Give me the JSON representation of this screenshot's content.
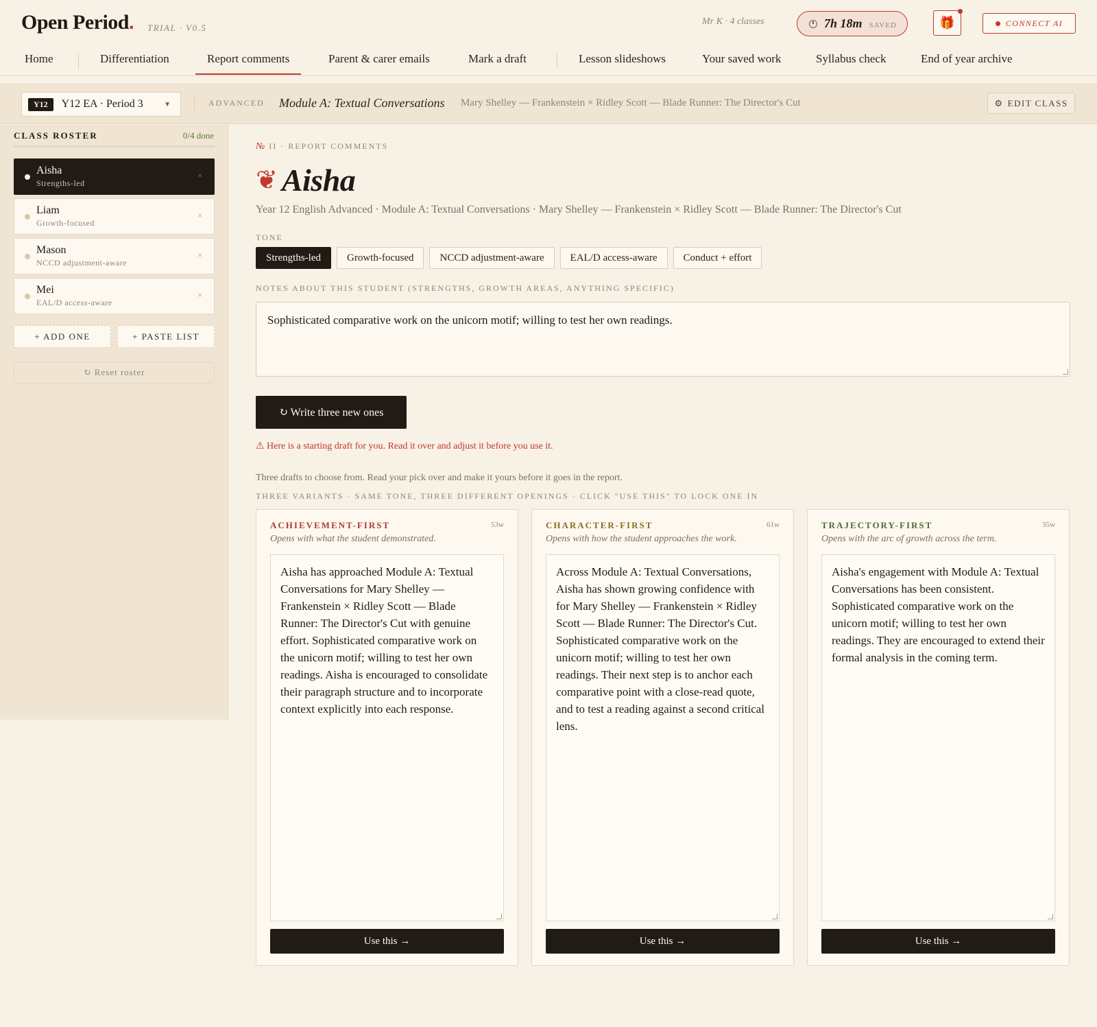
{
  "app": {
    "logo": "Open Period",
    "logo_dot": ".",
    "version": "TRIAL · V0.5",
    "teacher": "Mr K · 4 classes",
    "time_saved": "7h 18m",
    "time_saved_label": "SAVED",
    "gift_icon": "🎁",
    "connect_label": "CONNECT AI"
  },
  "nav": {
    "items": [
      "Home",
      "Differentiation",
      "Report comments",
      "Parent & carer emails",
      "Mark a draft",
      "Lesson slideshows",
      "Your saved work",
      "Syllabus check",
      "End of year archive"
    ],
    "active": "Report comments"
  },
  "classbar": {
    "badge": "Y12",
    "class_name": "Y12 EA · Period 3",
    "level": "ADVANCED",
    "module": "Module A: Textual Conversations",
    "texts": "Mary Shelley — Frankenstein × Ridley Scott — Blade Runner: The Director's Cut",
    "edit_label": "EDIT CLASS"
  },
  "roster": {
    "title": "CLASS ROSTER",
    "done": "0/4 done",
    "students": [
      {
        "name": "Aisha",
        "tone": "Strengths-led"
      },
      {
        "name": "Liam",
        "tone": "Growth-focused"
      },
      {
        "name": "Mason",
        "tone": "NCCD adjustment-aware"
      },
      {
        "name": "Mei",
        "tone": "EAL/D access-aware"
      }
    ],
    "remove_glyph": "×",
    "add_one": "+ ADD ONE",
    "paste_list": "+ PASTE LIST",
    "reset": "↻ Reset roster"
  },
  "main": {
    "kicker_no": "№",
    "kicker": "II · REPORT COMMENTS",
    "student_name": "Aisha",
    "apple_glyph": "❦",
    "subline": "Year 12 English Advanced · Module A: Textual Conversations · Mary Shelley — Frankenstein × Ridley Scott — Blade Runner: The Director's Cut",
    "tone_label": "TONE",
    "tones": [
      "Strengths-led",
      "Growth-focused",
      "NCCD adjustment-aware",
      "EAL/D access-aware",
      "Conduct + effort"
    ],
    "active_tone": "Strengths-led",
    "notes_label": "NOTES ABOUT THIS STUDENT (STRENGTHS, GROWTH AREAS, ANYTHING SPECIFIC)",
    "notes": "Sophisticated comparative work on the unicorn motif; willing to test her own readings.",
    "write_button": "↻ Write three new ones",
    "warning": "⚠ Here is a starting draft for you. Read it over and adjust it before you use it.",
    "drafts_intro": "Three drafts to choose from. Read your pick over and make it yours before it goes in the report.",
    "variants_label": "THREE VARIANTS · SAME TONE, THREE DIFFERENT OPENINGS · CLICK \"USE THIS\" TO LOCK ONE IN"
  },
  "drafts": [
    {
      "title": "ACHIEVEMENT-FIRST",
      "color": "#b03a2e",
      "words": "53w",
      "desc": "Opens with what the student demonstrated.",
      "text": "Aisha has approached Module A: Textual Conversations for Mary Shelley — Frankenstein × Ridley Scott — Blade Runner: The Director's Cut with genuine effort. Sophisticated comparative work on the unicorn motif; willing to test her own readings. Aisha is encouraged to consolidate their paragraph structure and to incorporate context explicitly into each response.",
      "button": "Use this →"
    },
    {
      "title": "CHARACTER-FIRST",
      "color": "#8a6d1f",
      "words": "61w",
      "desc": "Opens with how the student approaches the work.",
      "text": "Across Module A: Textual Conversations, Aisha has shown growing confidence with for Mary Shelley — Frankenstein × Ridley Scott — Blade Runner: The Director's Cut. Sophisticated comparative work on the unicorn motif; willing to test her own readings. Their next step is to anchor each comparative point with a close-read quote, and to test a reading against a second critical lens.",
      "button": "Use this →"
    },
    {
      "title": "TRAJECTORY-FIRST",
      "color": "#4f6b35",
      "words": "35w",
      "desc": "Opens with the arc of growth across the term.",
      "text": "Aisha's engagement with Module A: Textual Conversations has been consistent. Sophisticated comparative work on the unicorn motif; willing to test her own readings. They are encouraged to extend their formal analysis in the coming term.",
      "button": "Use this →"
    }
  ]
}
